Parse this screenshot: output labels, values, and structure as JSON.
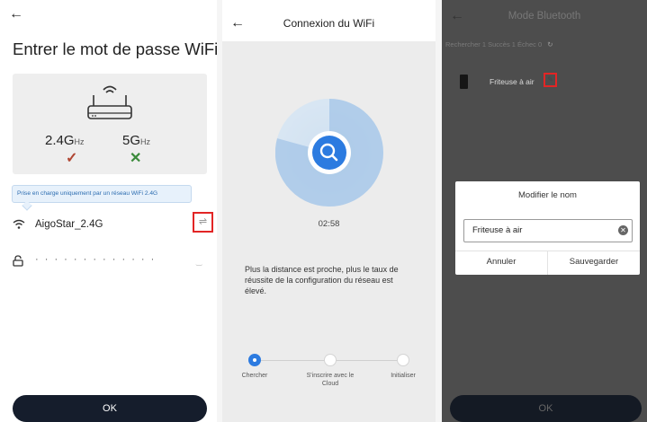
{
  "panel1": {
    "back_icon": "←",
    "title": "Entrer le mot de passe WiFi",
    "band_24": "2.4G",
    "band_24_unit": "Hz",
    "band_5": "5G",
    "band_5_unit": "Hz",
    "supported_24": "✓",
    "supported_5": "✕",
    "tip": "Prise en charge uniquement par un réseau WiFi 2.4G",
    "wifi_name": "AigoStar_2.4G",
    "switch_icon": "⇌",
    "password_mask": "· · · · · · · · · · · · ·",
    "eye_icon": "‿",
    "ok_label": "OK",
    "colors": {
      "ok_button": "#151d2c",
      "highlight": "#e22525",
      "check_ok": "#b04632",
      "check_no": "#3a8a3a"
    }
  },
  "panel2": {
    "back_icon": "←",
    "title": "Connexion du WiFi",
    "timer": "02:58",
    "description": "Plus la distance est proche, plus le taux de réussite de la configuration du réseau est élevé.",
    "steps": [
      {
        "label": "Chercher",
        "active": true
      },
      {
        "label": "S'inscrire avec le Cloud",
        "active": false
      },
      {
        "label": "Initialiser",
        "active": false
      }
    ],
    "colors": {
      "accent": "#2c7be0"
    }
  },
  "panel3": {
    "back_icon": "←",
    "title": "Mode Bluetooth",
    "stats": "Rechercher 1  Succès 1  Échec 0",
    "refresh_icon": "↻",
    "device_name": "Friteuse à air",
    "edit_icon": "✎",
    "dialog": {
      "title": "Modifier le nom",
      "input_value": "Friteuse à air",
      "clear_icon": "✕",
      "cancel": "Annuler",
      "save": "Sauvegarder"
    },
    "ok_label": "OK"
  }
}
